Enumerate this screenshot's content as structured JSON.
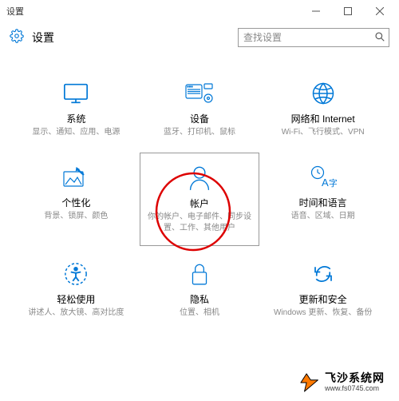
{
  "window": {
    "title": "设置"
  },
  "header": {
    "title": "设置"
  },
  "search": {
    "placeholder": "查找设置"
  },
  "tiles": [
    {
      "title": "系统",
      "desc": "显示、通知、应用、电源"
    },
    {
      "title": "设备",
      "desc": "蓝牙、打印机、鼠标"
    },
    {
      "title": "网络和 Internet",
      "desc": "Wi-Fi、飞行模式、VPN"
    },
    {
      "title": "个性化",
      "desc": "背景、锁屏、颜色"
    },
    {
      "title": "帐户",
      "desc": "你的帐户、电子邮件、同步设置、工作、其他用户"
    },
    {
      "title": "时间和语言",
      "desc": "语音、区域、日期"
    },
    {
      "title": "轻松使用",
      "desc": "讲述人、放大镜、高对比度"
    },
    {
      "title": "隐私",
      "desc": "位置、相机"
    },
    {
      "title": "更新和安全",
      "desc": "Windows 更新、恢复、备份"
    }
  ],
  "watermark": {
    "title": "飞沙系统网",
    "url": "www.fs0745.com"
  }
}
